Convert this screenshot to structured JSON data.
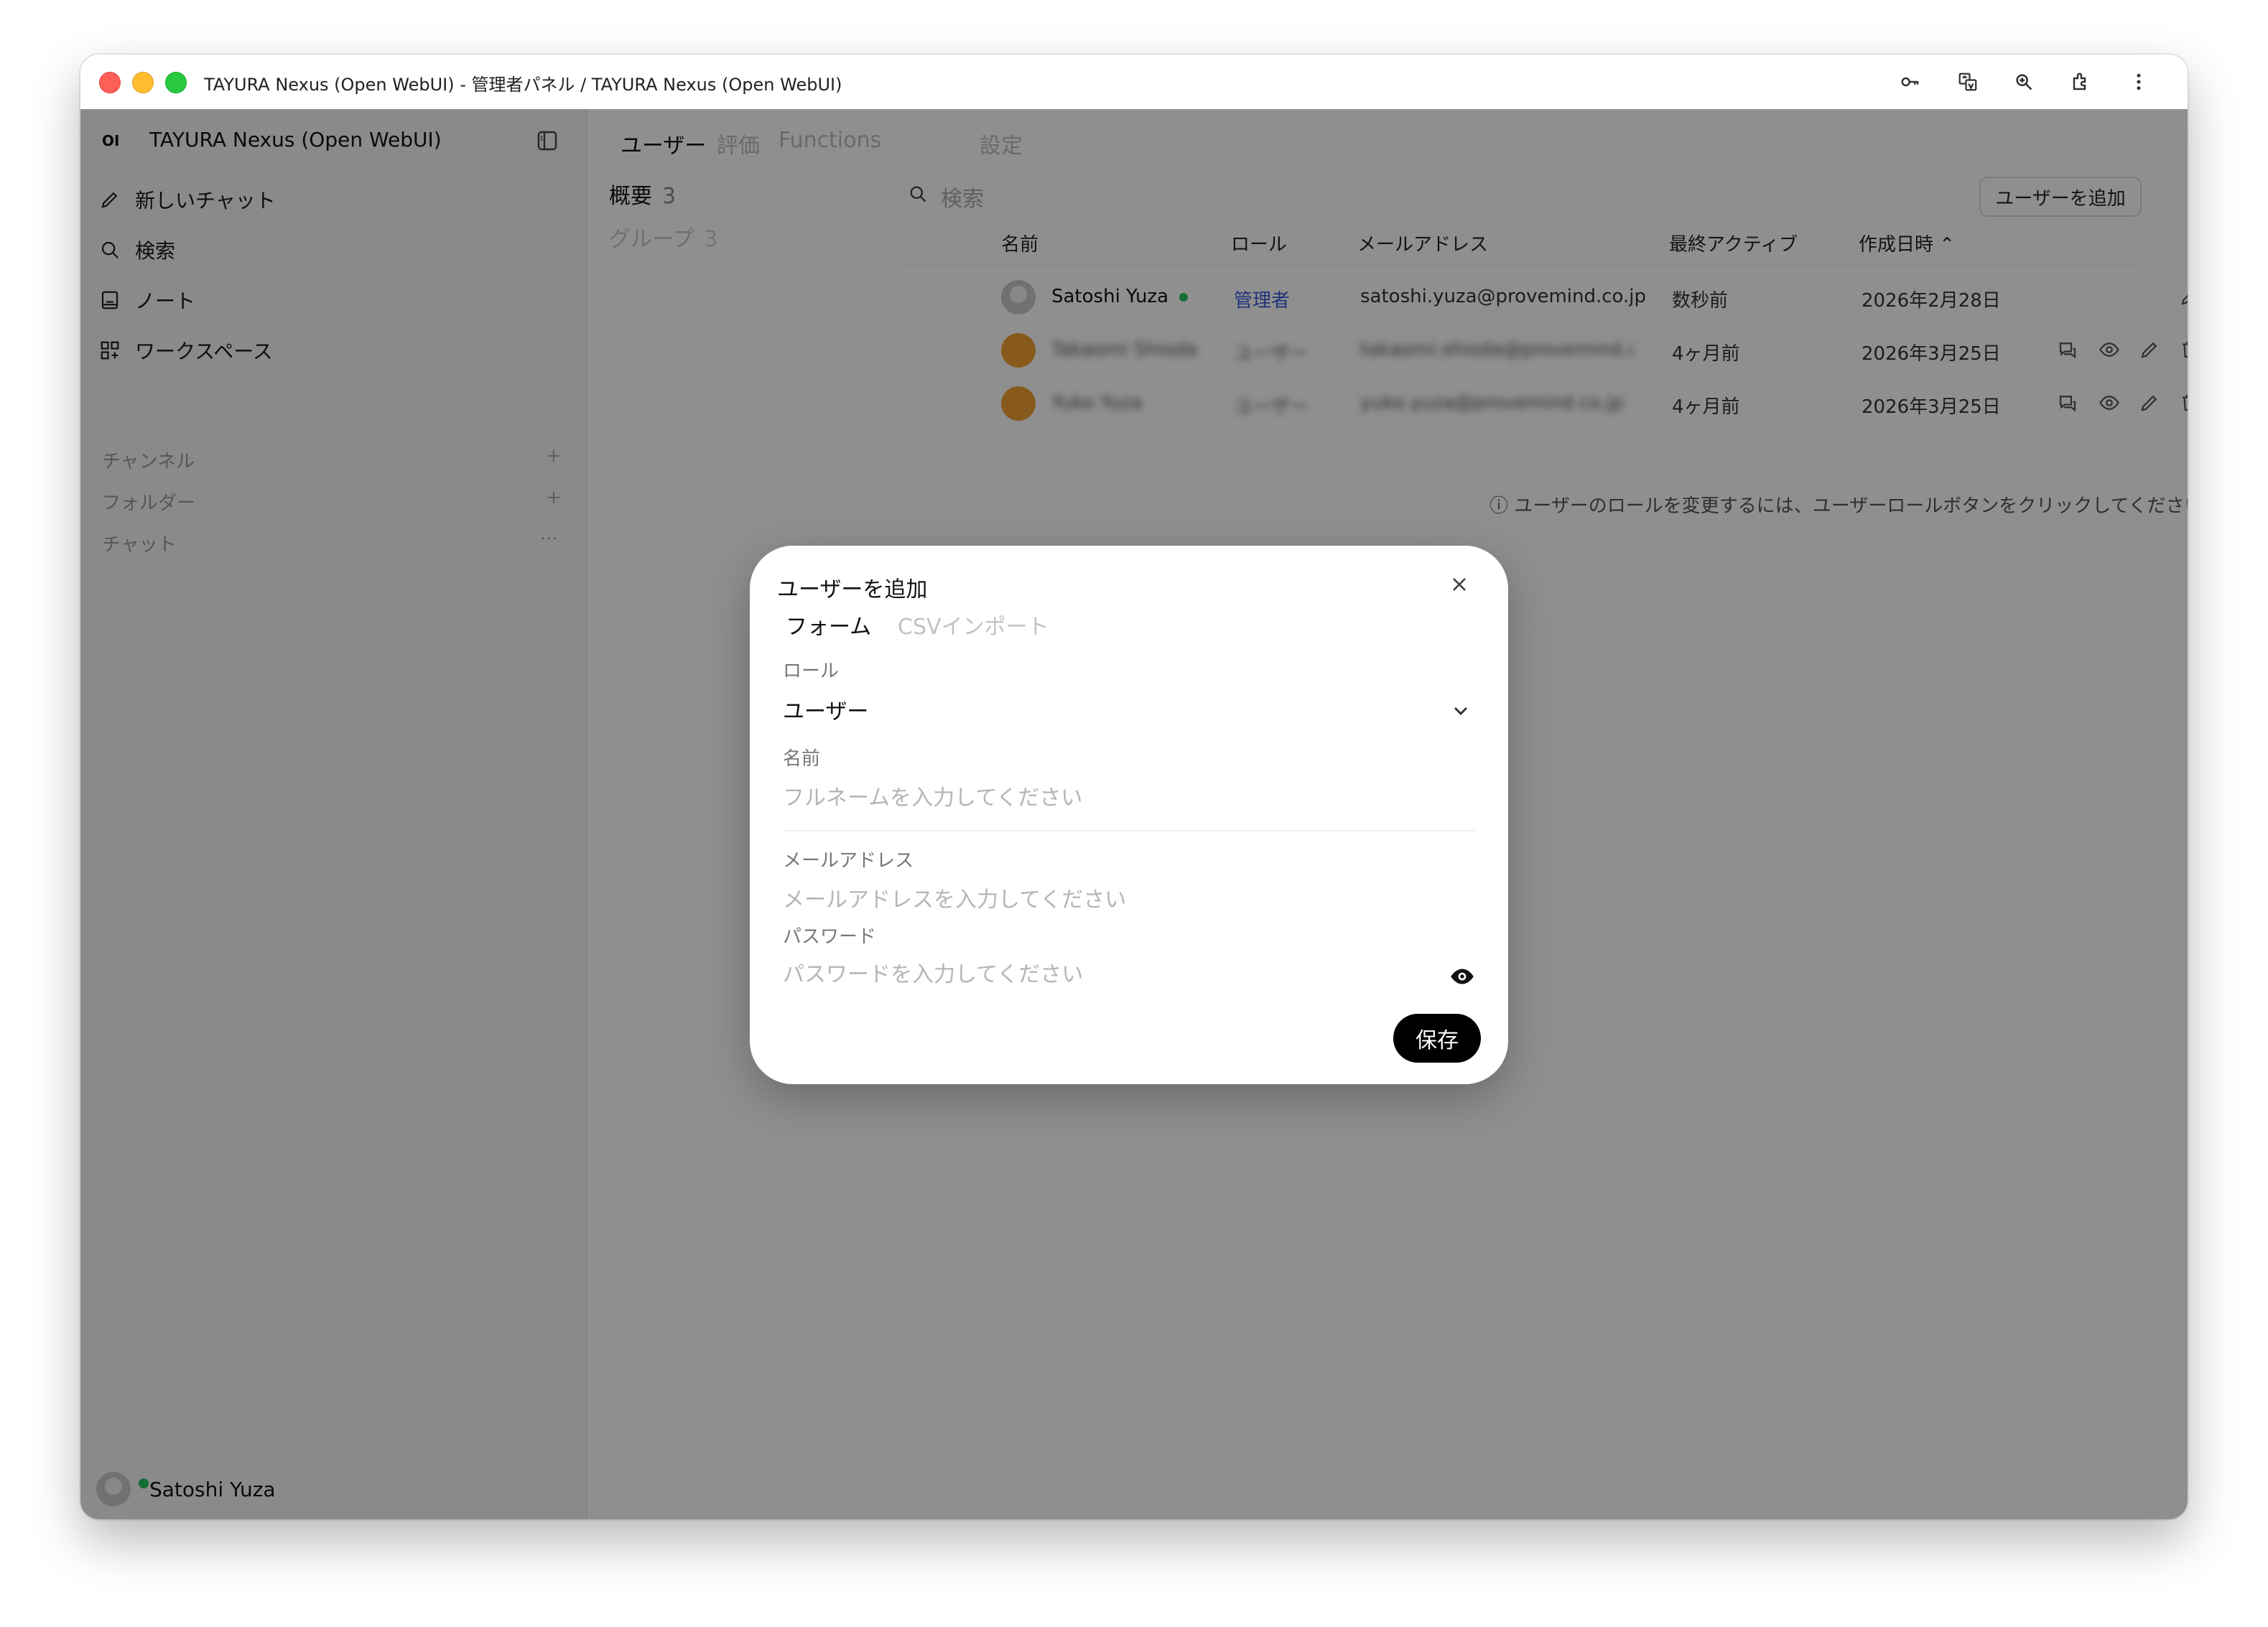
{
  "window": {
    "title": "TAYURA Nexus (Open WebUI) - 管理者パネル / TAYURA Nexus (Open WebUI)",
    "toolbar_icons": [
      "key-icon",
      "translate-icon",
      "zoom-icon",
      "extension-icon",
      "more-vertical-icon"
    ]
  },
  "sidebar": {
    "logo": "OI",
    "app_name": "TAYURA Nexus (Open WebUI)",
    "nav": [
      {
        "label": "新しいチャット",
        "icon": "pencil-icon"
      },
      {
        "label": "検索",
        "icon": "search-icon"
      },
      {
        "label": "ノート",
        "icon": "note-icon"
      },
      {
        "label": "ワークスペース",
        "icon": "grid-icon"
      }
    ],
    "sections": [
      {
        "label": "チャンネル",
        "action": "+"
      },
      {
        "label": "フォルダー",
        "action": "+"
      },
      {
        "label": "チャット",
        "action": "···"
      }
    ],
    "user_name": "Satoshi Yuza"
  },
  "main": {
    "tabs": [
      "ユーザー",
      "評価",
      "Functions",
      "設定"
    ],
    "side_nav": [
      {
        "label": "概要",
        "count": "3"
      },
      {
        "label": "グループ",
        "count": "3"
      }
    ],
    "search_placeholder": "検索",
    "add_user_label": "ユーザーを追加",
    "columns": [
      "名前",
      "ロール",
      "メールアドレス",
      "最終アクティブ",
      "作成日時 ⌃"
    ],
    "rows": [
      {
        "name": "Satoshi Yuza",
        "role": "管理者",
        "email": "satoshi.yuza@provemind.co.jp",
        "last_active": "数秒前",
        "created": "2026年2月28日"
      },
      {
        "name": "Takaomi Shioda",
        "role": "ユーザー",
        "email": "takaomi.shioda@provemind.co.jp",
        "last_active": "4ヶ月前",
        "created": "2026年3月25日"
      },
      {
        "name": "Yuko Yuza",
        "role": "ユーザー",
        "email": "yuko.yuza@provemind.co.jp",
        "last_active": "4ヶ月前",
        "created": "2026年3月25日"
      }
    ],
    "hint": "ⓘ ユーザーのロールを変更するには、ユーザーロールボタンをクリックしてください。"
  },
  "modal": {
    "title": "ユーザーを追加",
    "tabs": [
      "フォーム",
      "CSVインポート"
    ],
    "role_label": "ロール",
    "role_value": "ユーザー",
    "name_label": "名前",
    "name_placeholder": "フルネームを入力してください",
    "email_label": "メールアドレス",
    "email_placeholder": "メールアドレスを入力してください",
    "password_label": "パスワード",
    "password_placeholder": "パスワードを入力してください",
    "save_label": "保存"
  },
  "colors": {
    "admin_role": "#3b5bdb",
    "online": "#22c55e",
    "avatar_orange": "#f0a030",
    "primary_button": "#000000"
  }
}
